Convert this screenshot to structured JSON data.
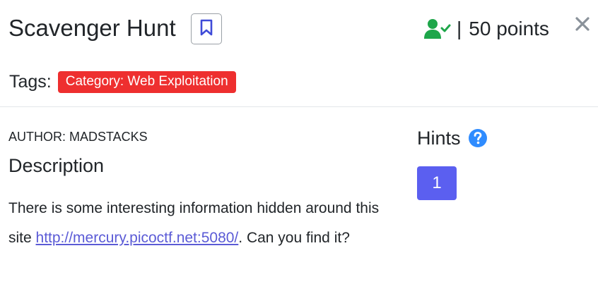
{
  "challenge": {
    "title": "Scavenger Hunt",
    "points_separator": "|",
    "points": "50 points",
    "solved_icon": "user-check-icon",
    "bookmark_icon": "bookmark-icon",
    "close_icon": "close-icon"
  },
  "tags": {
    "label": "Tags:",
    "items": [
      "Category: Web Exploitation"
    ]
  },
  "author": "AUTHOR: MADSTACKS",
  "description": {
    "heading": "Description",
    "text_before": "There is some interesting information hidden around this site ",
    "link": "http://mercury.picoctf.net:5080/",
    "text_after": ". Can you find it?"
  },
  "hints": {
    "heading": "Hints",
    "help_icon": "question-circle-icon",
    "buttons": [
      "1"
    ]
  },
  "colors": {
    "tag_red": "#ee2f2f",
    "solved_green": "#1ea64a",
    "hint_blue": "#5b5ff0",
    "help_blue": "#2f8cff",
    "bookmark_blue": "#3f4bd8",
    "link": "#5b5bd6"
  }
}
